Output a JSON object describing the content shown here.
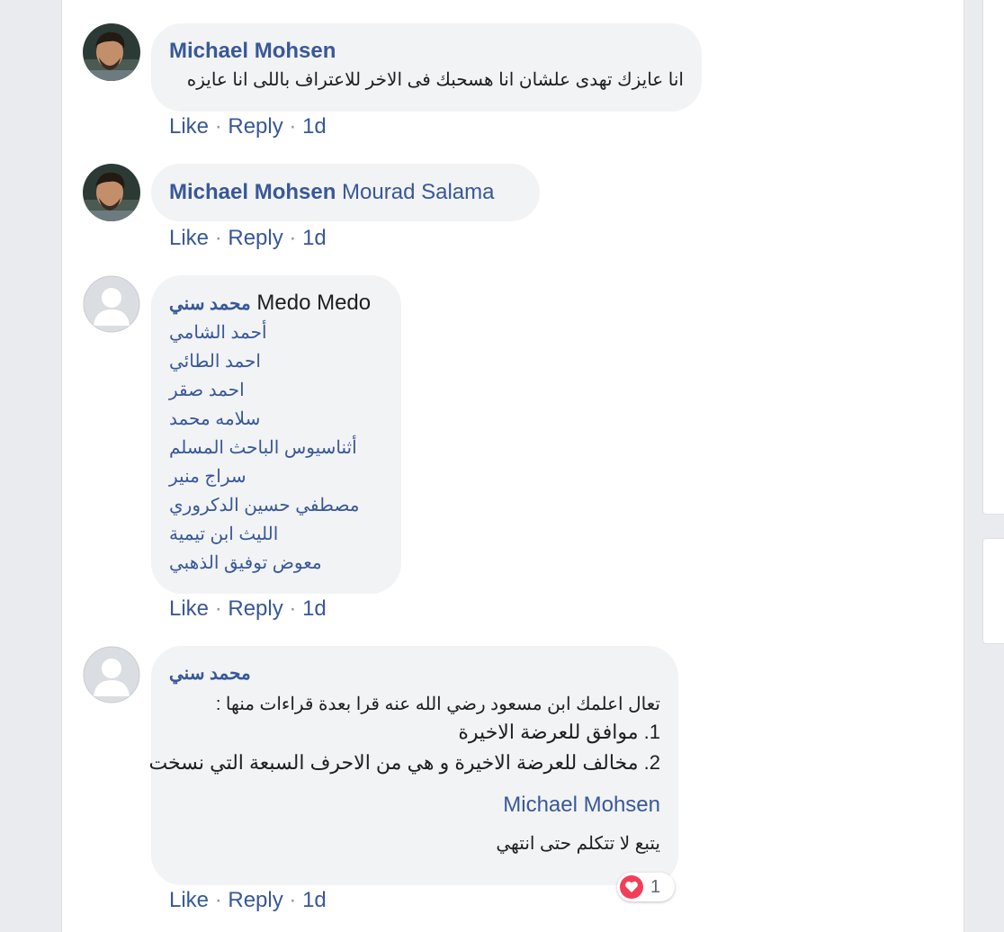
{
  "comments": [
    {
      "author": "Michael Mohsen",
      "text": "انا عايزك تهدى علشان انا هسحبك فى الاخر للاعتراف باللى انا عايزه",
      "like": "Like",
      "reply": "Reply",
      "time": "1d"
    },
    {
      "author": "Michael Mohsen",
      "mention": "Mourad Salama",
      "like": "Like",
      "reply": "Reply",
      "time": "1d"
    },
    {
      "author": "محمد سني",
      "lead": "Medo Medo",
      "mentions": [
        "أحمد الشامي",
        "احمد الطائي",
        "احمد صقر",
        "سلامه محمد",
        "أثناسيوس الباحث المسلم",
        "سراج منير",
        "مصطفي حسين الدكروري",
        "الليث ابن تيمية",
        "معوض توفيق الذهبي"
      ],
      "like": "Like",
      "reply": "Reply",
      "time": "1d"
    },
    {
      "author": "محمد سني",
      "line1": "تعال اعلمك ابن مسعود رضي الله عنه قرا بعدة قراءات منها :",
      "line2": "1. موافق للعرضة الاخيرة",
      "line3": "2. مخالف للعرضة الاخيرة و هي من الاحرف السبعة التي نسخت",
      "mention": "Michael Mohsen",
      "line4": "يتبع لا تتكلم حتى انتهي",
      "reaction_count": "1",
      "like": "Like",
      "reply": "Reply",
      "time": "1d"
    }
  ],
  "separator": "·",
  "colors": {
    "link": "#385898",
    "bubble": "#f2f3f5",
    "meta": "#90949c",
    "heart": "#f33e58"
  },
  "icons": {
    "reaction": "heart-icon",
    "avatar_placeholder": "default-avatar-icon"
  }
}
